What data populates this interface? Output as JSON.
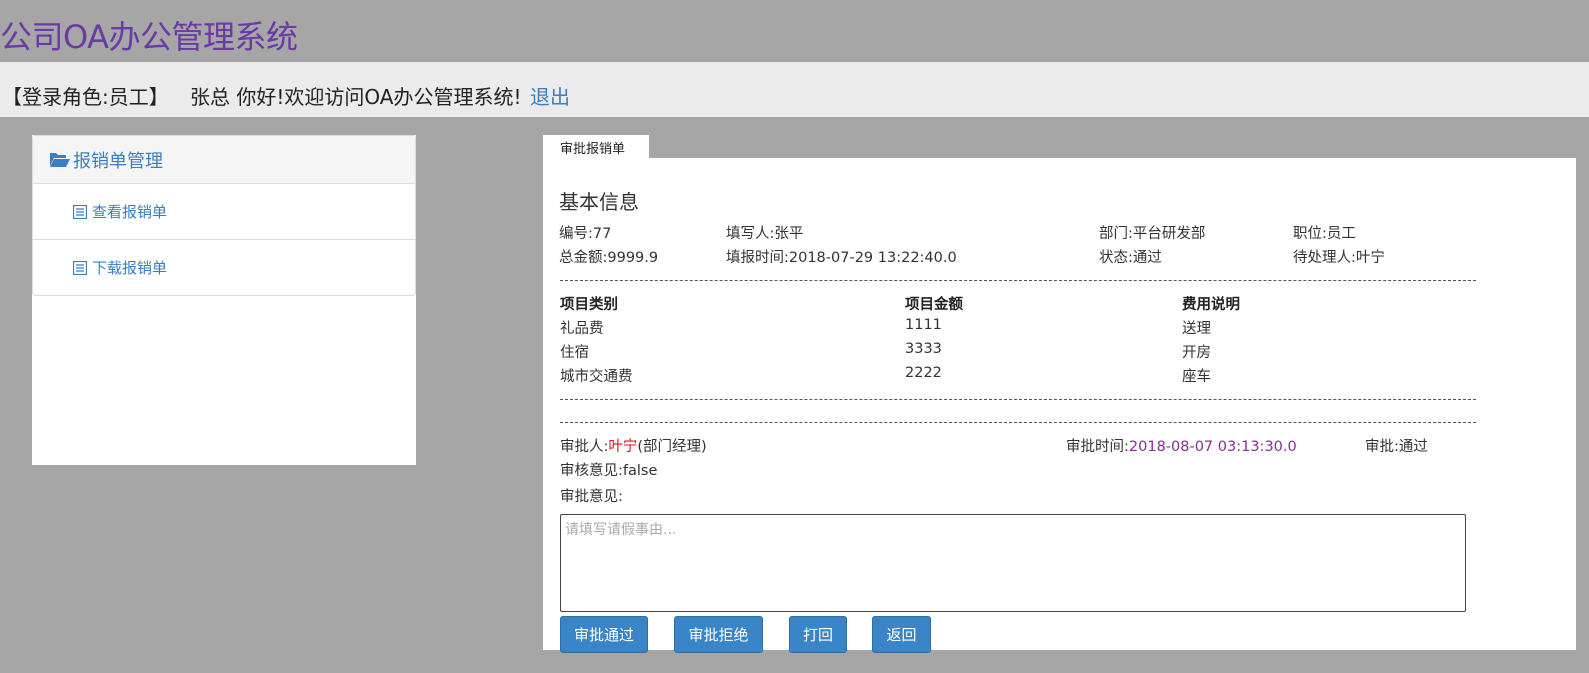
{
  "header": {
    "title": "公司OA办公管理系统"
  },
  "user_bar": {
    "role": "【登录角色:员工】",
    "welcome": "张总 你好!欢迎访问OA办公管理系统!",
    "logout": "退出"
  },
  "sidebar": {
    "header": "报销单管理",
    "items": [
      {
        "label": "查看报销单"
      },
      {
        "label": "下载报销单"
      }
    ]
  },
  "tab": {
    "label": "审批报销单"
  },
  "basic_info": {
    "title": "基本信息",
    "id": "编号:77",
    "writer": "填写人:张平",
    "department": "部门:平台研发部",
    "position": "职位:员工",
    "total": "总金额:9999.9",
    "fill_time": "填报时间:2018-07-29 13:22:40.0",
    "status": "状态:通过",
    "pending": "待处理人:叶宁"
  },
  "items_table": {
    "headers": [
      "项目类别",
      "项目金额",
      "费用说明"
    ],
    "rows": [
      [
        "礼品费",
        "1111",
        "送理"
      ],
      [
        "住宿",
        "3333",
        "开房"
      ],
      [
        "城市交通费",
        "2222",
        "座车"
      ]
    ]
  },
  "approval": {
    "approver_label": "审批人:",
    "approver_name": "叶宁",
    "approver_role": "(部门经理)",
    "time_label": "审批时间:",
    "time_value": "2018-08-07 03:13:30.0",
    "result": "审批:通过",
    "review_opinion": "审核意见:false",
    "opinion_label": "审批意见:",
    "opinion_placeholder": "请填写请假事由..."
  },
  "buttons": {
    "approve": "审批通过",
    "reject": "审批拒绝",
    "print": "打回",
    "back": "返回"
  },
  "colors": {
    "background": "#a6a6a6",
    "title": "#6a3aa5",
    "link": "#3a7fc4",
    "button": "#3a85c8",
    "approver_name": "#e0131b",
    "approval_time": "#8a2d95"
  }
}
